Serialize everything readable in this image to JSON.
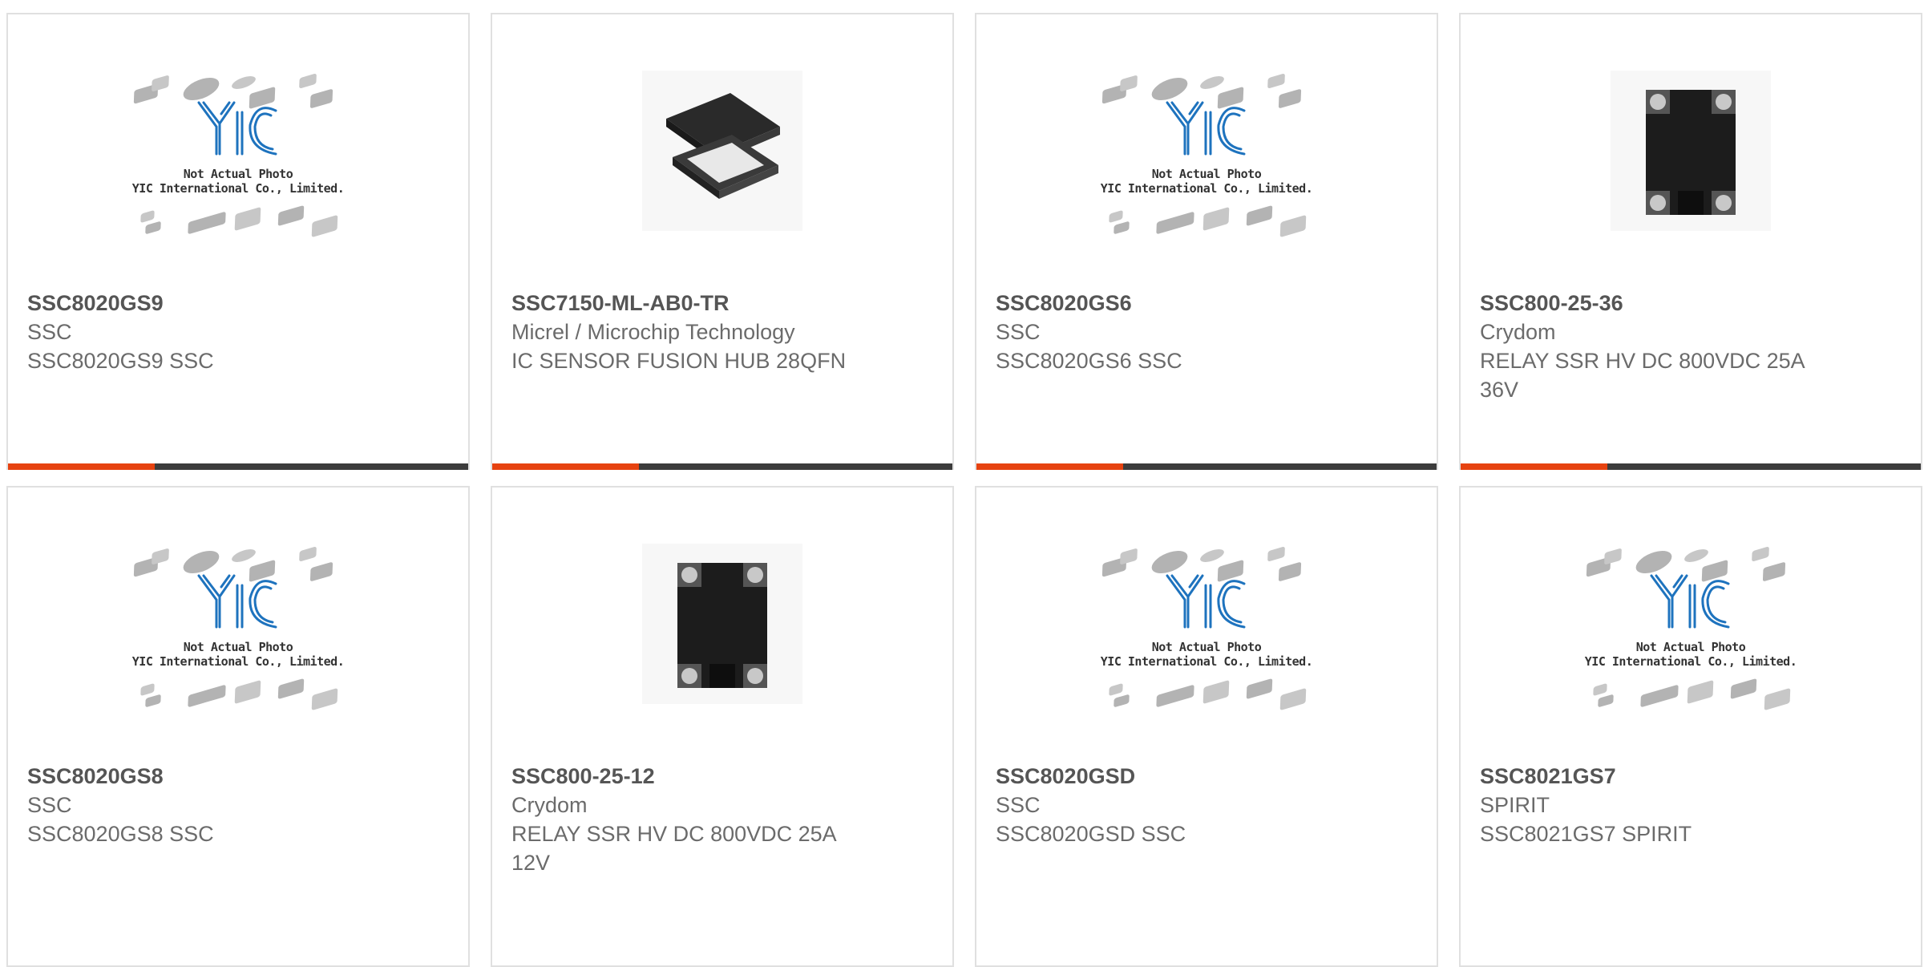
{
  "colors": {
    "accent": "#e64210",
    "bar": "#3c3c3c",
    "logo_blue": "#1e73be",
    "card_border": "#e0e0e0"
  },
  "placeholder": {
    "line1": "Not Actual Photo",
    "line2": "YIC International Co., Limited."
  },
  "products": [
    {
      "part": "SSC8020GS9",
      "mfr": "SSC",
      "desc": "SSC8020GS9 SSC",
      "image": "placeholder"
    },
    {
      "part": "SSC7150-ML-AB0-TR",
      "mfr": "Micrel / Microchip Technology",
      "desc": "IC SENSOR FUSION HUB 28QFN",
      "image": "qfn-chip"
    },
    {
      "part": "SSC8020GS6",
      "mfr": "SSC",
      "desc": "SSC8020GS6 SSC",
      "image": "placeholder"
    },
    {
      "part": "SSC800-25-36",
      "mfr": "Crydom",
      "desc": "RELAY SSR HV DC 800VDC 25A 36V",
      "image": "relay"
    },
    {
      "part": "SSC8020GS8",
      "mfr": "SSC",
      "desc": "SSC8020GS8 SSC",
      "image": "placeholder"
    },
    {
      "part": "SSC800-25-12",
      "mfr": "Crydom",
      "desc": "RELAY SSR HV DC 800VDC 25A 12V",
      "image": "relay"
    },
    {
      "part": "SSC8020GSD",
      "mfr": "SSC",
      "desc": "SSC8020GSD SSC",
      "image": "placeholder"
    },
    {
      "part": "SSC8021GS7",
      "mfr": "SPIRIT",
      "desc": "SSC8021GS7 SPIRIT",
      "image": "placeholder"
    }
  ],
  "relay_label": "crydom"
}
